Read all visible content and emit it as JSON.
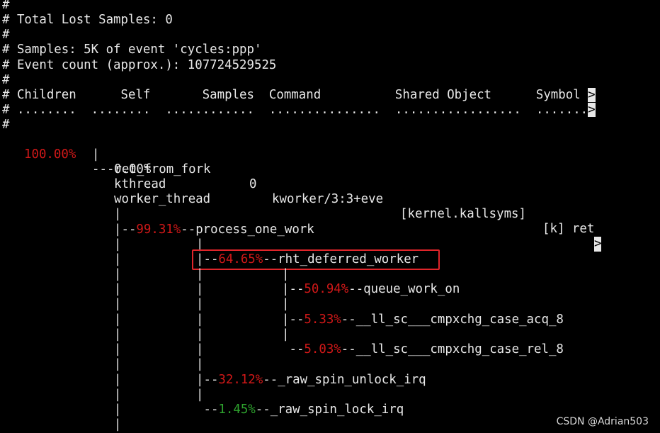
{
  "header": [
    "#",
    "# Total Lost Samples: 0",
    "#",
    "# Samples: 5K of event 'cycles:ppp'",
    "# Event count (approx.): 107724529525",
    "#"
  ],
  "columns_line": "# Children      Self       Samples  Command          Shared Object      Symbol ",
  "dots_line": "# ........  ........  ............  ...............  .................  .......",
  "hash_after": "#",
  "more_marker": ">",
  "row": {
    "children_pct": "100.00%",
    "self_pct": "0.00%",
    "samples": "0",
    "command": "kworker/3:3+eve",
    "shared_object": "[kernel.kallsyms]",
    "symbol": "[k] ret"
  },
  "callchain": {
    "root": "ret_from_fork",
    "kthread": "kthread",
    "worker_thread": "worker_thread",
    "process_one_work": {
      "pct": "99.31%",
      "name": "process_one_work"
    },
    "rht_deferred_worker": {
      "pct": "64.65%",
      "name": "rht_deferred_worker"
    },
    "queue_work_on": {
      "pct": "50.94%",
      "name": "queue_work_on"
    },
    "cmpxchg_acq": {
      "pct": "5.33%",
      "name": "__ll_sc___cmpxchg_case_acq_8"
    },
    "cmpxchg_rel": {
      "pct": "5.03%",
      "name": "__ll_sc___cmpxchg_case_rel_8"
    },
    "raw_spin_unlock_irq": {
      "pct": "32.12%",
      "name": "_raw_spin_unlock_irq"
    },
    "raw_spin_lock_irq": {
      "pct": "1.45%",
      "name": "_raw_spin_lock_irq"
    }
  },
  "watermark": "CSDN @Adrian503",
  "colors": {
    "background": "#000000",
    "text": "#e8e8e8",
    "percent_red": "#d01818",
    "percent_green": "#2ea32e",
    "highlight_box": "#e0252a"
  }
}
